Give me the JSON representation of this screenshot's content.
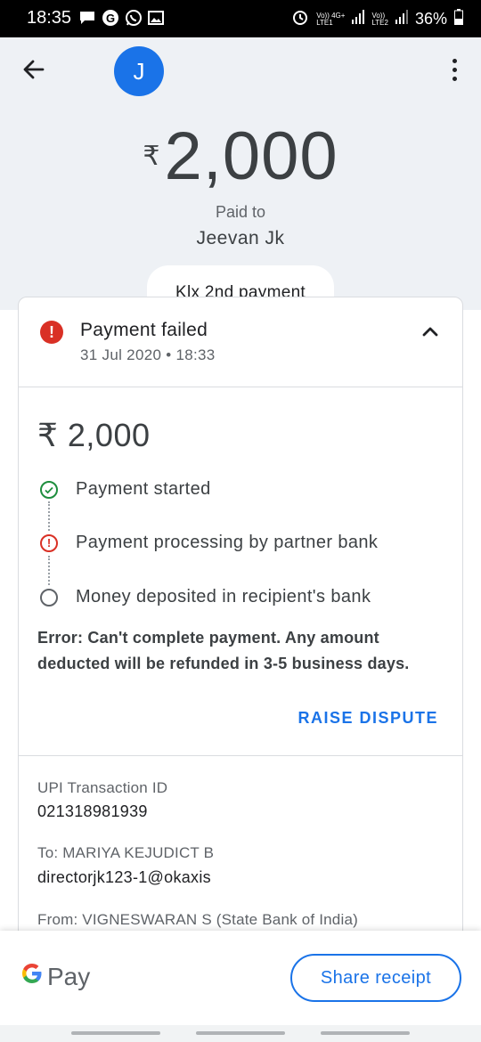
{
  "status_bar": {
    "time": "18:35",
    "left_icons": [
      "message-icon",
      "g-icon",
      "whatsapp-icon",
      "gallery-icon"
    ],
    "right_icons": [
      "alarm-icon",
      "signal-lte1-icon",
      "signal-lte2-icon",
      "battery-icon"
    ],
    "sim1_label": "Vo)) 4G+\nLTE1",
    "sim2_label": "Vo))\nLTE2",
    "battery": "36%"
  },
  "header": {
    "avatar_initial": "J",
    "currency_symbol": "₹",
    "amount": "2,000",
    "paid_to_label": "Paid to",
    "payee_name": "Jeevan Jk",
    "note": "Klx 2nd payment"
  },
  "status_card": {
    "title": "Payment failed",
    "date": "31 Jul 2020 • 18:33",
    "amount": "₹ 2,000",
    "steps": [
      {
        "label": "Payment started",
        "state": "done"
      },
      {
        "label": "Payment processing by partner bank",
        "state": "error"
      },
      {
        "label": "Money deposited in recipient's bank",
        "state": "pending"
      }
    ],
    "error_message": "Error: Can't complete payment. Any amount deducted will be refunded in 3-5 business days.",
    "dispute_label": "RAISE DISPUTE"
  },
  "details": {
    "txn_label": "UPI Transaction ID",
    "txn_id": "021318981939",
    "to_label": "To: MARIYA KEJUDICT B",
    "to_vpa": "directorjk123-1@okaxis",
    "from_label": "From: VIGNESWARAN  S (State Bank of India)"
  },
  "bottom": {
    "brand_g": "G",
    "brand_pay": "Pay",
    "share_label": "Share receipt"
  },
  "colors": {
    "accent": "#1a73e8",
    "error": "#d93025",
    "success": "#1e8e3e",
    "header_bg": "#eef1f5"
  }
}
